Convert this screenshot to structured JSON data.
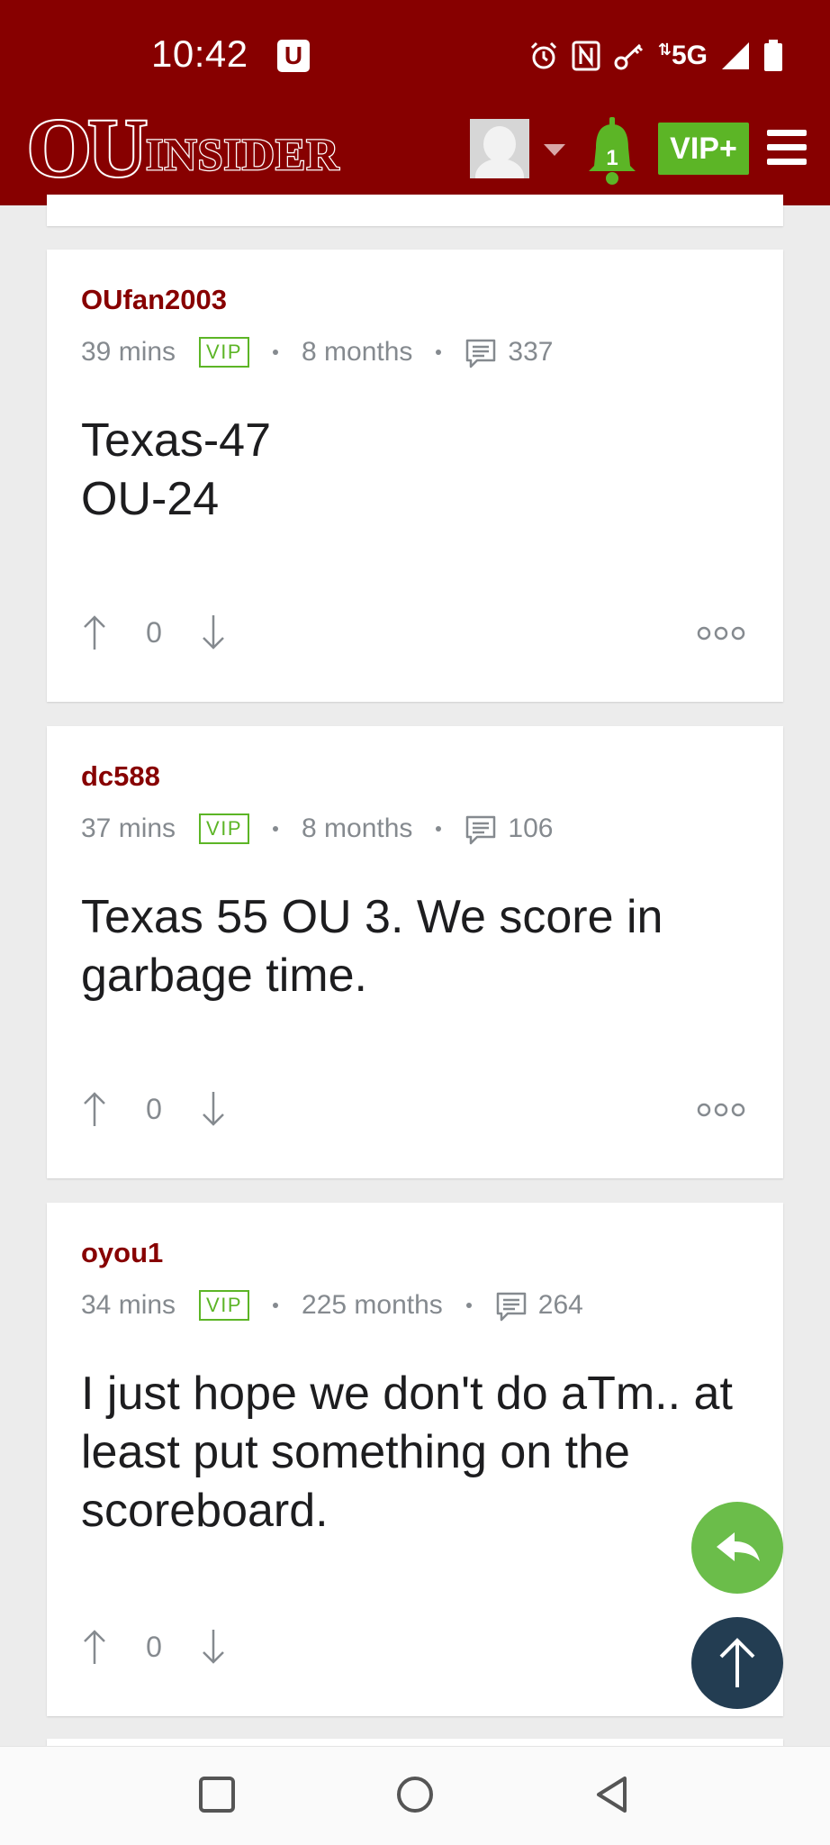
{
  "status_bar": {
    "time": "10:42",
    "app_badge": "U",
    "network": "5G",
    "icons": [
      "alarm-icon",
      "nfc-icon",
      "key-icon",
      "signal-icon",
      "battery-icon"
    ]
  },
  "header": {
    "logo_ou": "OU",
    "logo_insider": "INSIDER",
    "notification_count": "1",
    "vip_button_label": "VIP+",
    "colors": {
      "brand": "#870000",
      "accent": "#5cb526"
    }
  },
  "posts": [
    {
      "username": "OUfan2003",
      "time_ago": "39 mins",
      "badge": "VIP",
      "member_since": "8 months",
      "post_count": "337",
      "body": "Texas-47\nOU-24",
      "votes": "0"
    },
    {
      "username": "dc588",
      "time_ago": "37 mins",
      "badge": "VIP",
      "member_since": "8 months",
      "post_count": "106",
      "body": "Texas 55 OU 3. We score in garbage time.",
      "votes": "0"
    },
    {
      "username": "oyou1",
      "time_ago": "34 mins",
      "badge": "VIP",
      "member_since": "225 months",
      "post_count": "264",
      "body": "I just hope we don't do aTm.. at least put something on the scoreboard.",
      "votes": "0"
    }
  ],
  "fab": {
    "reply_color": "#6bbd4a",
    "scroll_top_color": "#233d52"
  },
  "nav": [
    "recents-icon",
    "home-icon",
    "back-icon"
  ]
}
